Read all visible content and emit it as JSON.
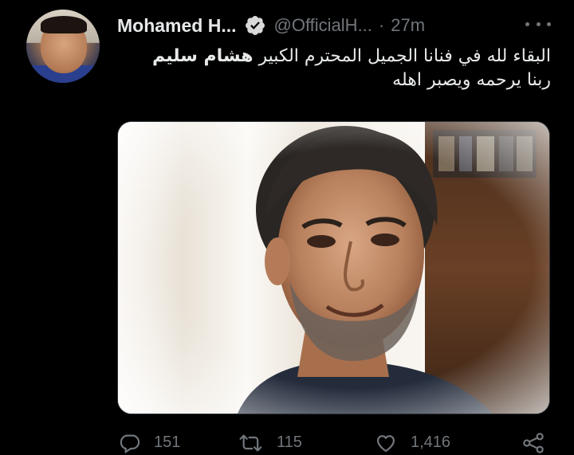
{
  "tweet": {
    "author": {
      "display_name": "Mohamed H...",
      "handle": "@OfficialH...",
      "verified": true
    },
    "separator": "·",
    "timestamp": "27m",
    "text": {
      "line1_prefix": "البقاء لله في فنانا الجميل المحترم الكبير",
      "line1_bold": "هشام سليم",
      "line2": "ربنا يرحمه ويصبر اهله"
    },
    "media": {
      "type": "photo"
    },
    "actions": {
      "reply_count": "151",
      "retweet_count": "115",
      "like_count": "1,416"
    }
  },
  "icons": {
    "verified": "verified-badge-icon",
    "more": "more-options-icon",
    "reply": "reply-icon",
    "retweet": "retweet-icon",
    "like": "heart-icon",
    "share": "share-icon"
  },
  "colors": {
    "background": "#000000",
    "primary_text": "#e7e9ea",
    "secondary_text": "#71767b",
    "verified_badge": "#d9d9d9"
  }
}
